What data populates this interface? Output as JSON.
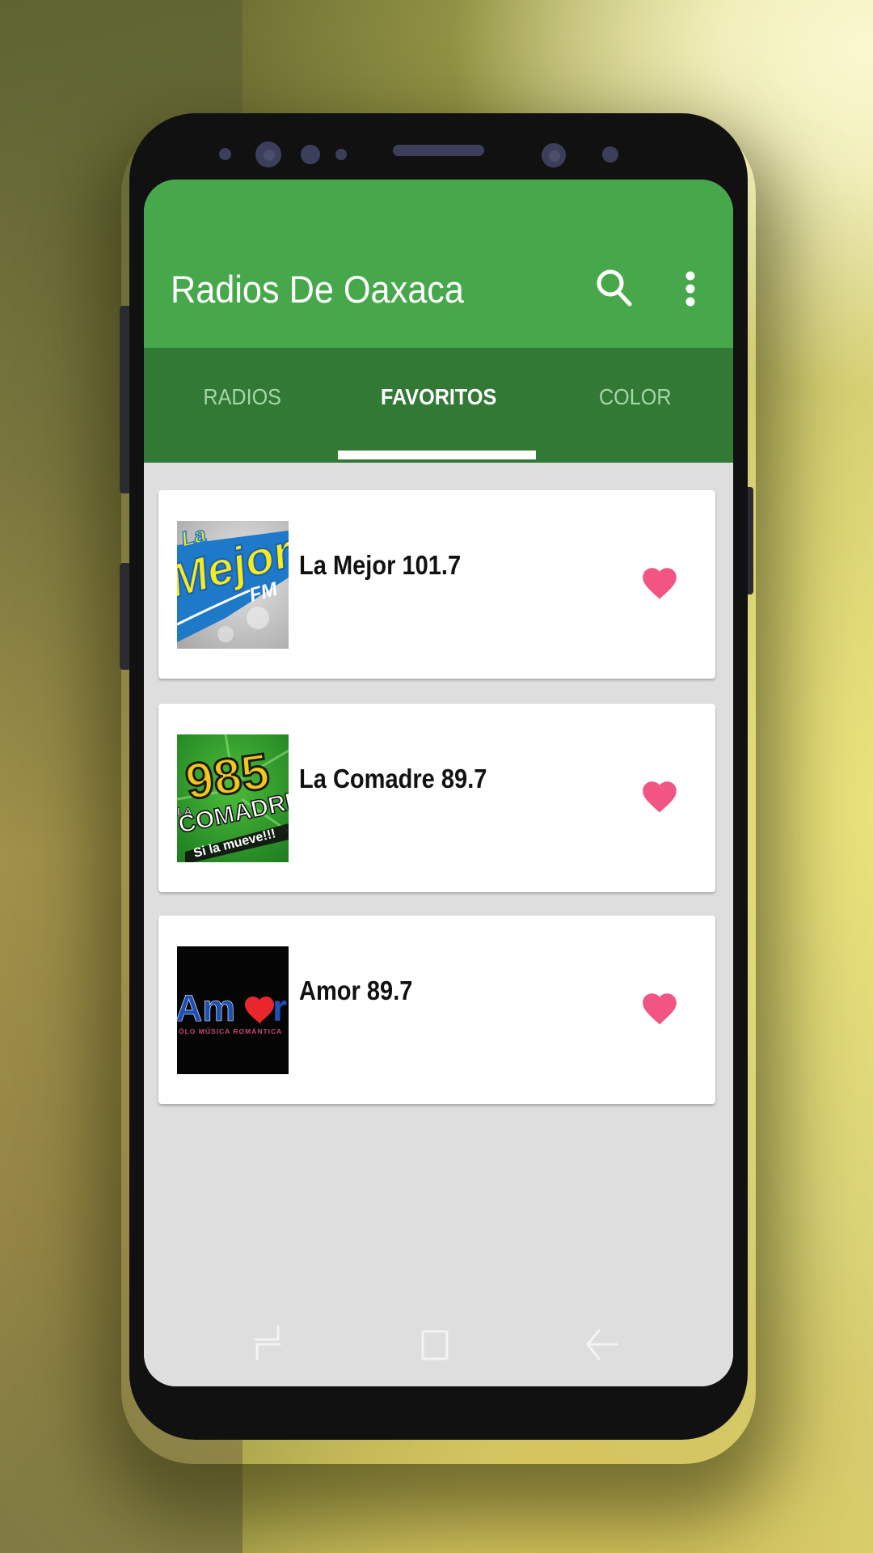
{
  "app": {
    "title": "Radios De Oaxaca",
    "actions": [
      {
        "name": "search",
        "icon": "search-icon"
      },
      {
        "name": "more-options",
        "icon": "more-vert-icon"
      }
    ]
  },
  "tabs": [
    {
      "label": "RADIOS",
      "active": false
    },
    {
      "label": "FAVORITOS",
      "active": true
    },
    {
      "label": "COLOR",
      "active": false
    }
  ],
  "favorites": [
    {
      "name": "La Mejor 101.7",
      "logo": {
        "text_top": "La",
        "text_main": "Mejor",
        "text_sub": "FM"
      },
      "favorite": true,
      "heart_icon": "heart-icon"
    },
    {
      "name": "La Comadre 89.7",
      "logo": {
        "text_top": "985",
        "text_main": "COMADRE",
        "text_sub": "Si la mueve!!!",
        "text_left": "LA"
      },
      "favorite": true,
      "heart_icon": "heart-icon"
    },
    {
      "name": "Amor 89.7",
      "logo": {
        "text_main": "Amor",
        "text_sub": "SÓLO MÚSICA ROMÁNTICA"
      },
      "favorite": true,
      "heart_icon": "heart-icon"
    }
  ],
  "navbar": [
    {
      "name": "recent-apps",
      "icon": "recents-icon"
    },
    {
      "name": "home",
      "icon": "home-icon"
    },
    {
      "name": "back",
      "icon": "back-arrow-icon"
    }
  ],
  "colors": {
    "primary": "#47a84b",
    "primary_dark": "#317935",
    "accent_heart": "#f25584",
    "tab_inactive": "#a5d6a7",
    "content_bg": "#dedede"
  }
}
